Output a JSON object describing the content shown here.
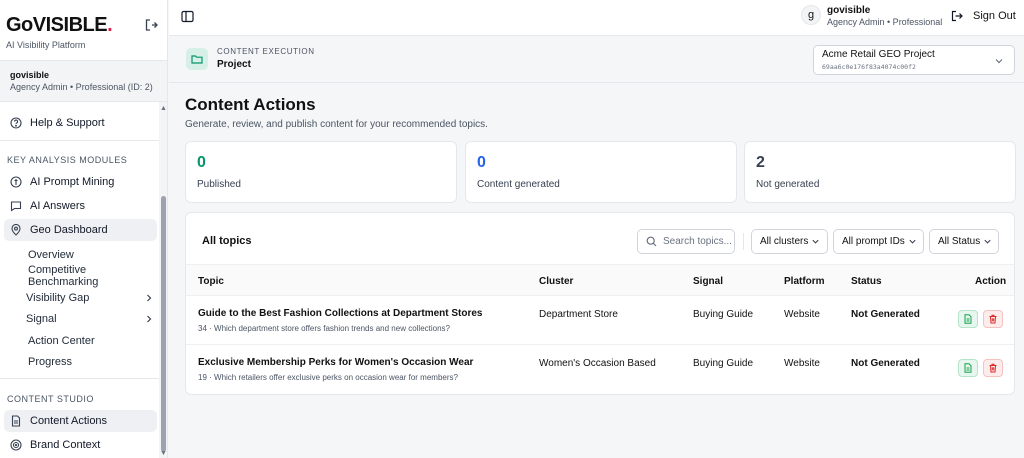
{
  "brand": {
    "logo_main": "GoVISIBLE",
    "logo_dot": ".",
    "tagline": "AI Visibility Platform",
    "dot_color": "#e11d48"
  },
  "sidebar": {
    "user_name": "govisible",
    "user_role": "Agency Admin • Professional (ID: 2)",
    "help_label": "Help & Support",
    "section_analysis": "KEY ANALYSIS MODULES",
    "analysis_items": [
      {
        "label": "AI Prompt Mining",
        "icon": "bulb-icon"
      },
      {
        "label": "AI Answers",
        "icon": "message-icon"
      },
      {
        "label": "Geo Dashboard",
        "icon": "map-pin-icon"
      }
    ],
    "geo_sub_items": [
      {
        "label": "Overview"
      },
      {
        "label": "Competitive Benchmarking"
      },
      {
        "label": "Visibility Gap"
      },
      {
        "label": "Signal"
      },
      {
        "label": "Action Center"
      },
      {
        "label": "Progress"
      }
    ],
    "section_studio": "CONTENT STUDIO",
    "studio_items": [
      {
        "label": "Content Actions",
        "icon": "document-icon"
      },
      {
        "label": "Brand Context",
        "icon": "target-icon"
      }
    ]
  },
  "topbar": {
    "avatar_initial": "g",
    "user_name": "govisible",
    "user_role": "Agency Admin • Professional",
    "signout_label": "Sign Out"
  },
  "subbar": {
    "label": "CONTENT EXECUTION",
    "value": "Project",
    "project_name": "Acme Retail GEO Project",
    "project_id": "69aa6c0e176f83a4074c00f2"
  },
  "page": {
    "title": "Content Actions",
    "subtitle": "Generate, review, and publish content for your recommended topics."
  },
  "stats": [
    {
      "value": "0",
      "label": "Published",
      "color": "#059669"
    },
    {
      "value": "0",
      "label": "Content generated",
      "color": "#2563eb"
    },
    {
      "value": "2",
      "label": "Not generated",
      "color": "#374151"
    }
  ],
  "table": {
    "title": "All topics",
    "search_placeholder": "Search topics...",
    "filters": [
      "All clusters",
      "All prompt IDs",
      "All Status"
    ],
    "columns": [
      "Topic",
      "Cluster",
      "Signal",
      "Platform",
      "Status",
      "Action"
    ],
    "rows": [
      {
        "title": "Guide to the Best Fashion Collections at Department Stores",
        "id": "34",
        "question": "Which department store offers fashion trends and new collections?",
        "cluster": "Department Store",
        "signal": "Buying Guide",
        "platform": "Website",
        "status": "Not Generated"
      },
      {
        "title": "Exclusive Membership Perks for Women's Occasion Wear",
        "id": "19",
        "question": "Which retailers offer exclusive perks on occasion wear for members?",
        "cluster": "Women's Occasion Based",
        "signal": "Buying Guide",
        "platform": "Website",
        "status": "Not Generated"
      }
    ]
  }
}
